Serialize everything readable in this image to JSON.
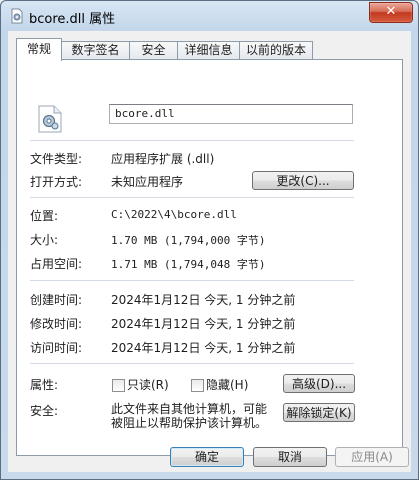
{
  "window": {
    "title": "bcore.dll 属性",
    "close_glyph": "✕"
  },
  "tabs": [
    "常规",
    "数字签名",
    "安全",
    "详细信息",
    "以前的版本"
  ],
  "file": {
    "name": "bcore.dll"
  },
  "rows": {
    "type_label": "文件类型:",
    "type_value": "应用程序扩展 (.dll)",
    "open_label": "打开方式:",
    "open_value": "未知应用程序",
    "change_button": "更改(C)...",
    "location_label": "位置:",
    "location_value": "C:\\2022\\4\\bcore.dll",
    "size_label": "大小:",
    "size_value": "1.70 MB (1,794,000 字节)",
    "disk_label": "占用空间:",
    "disk_value": "1.71 MB (1,794,048 字节)",
    "created_label": "创建时间:",
    "created_value": "2024年1月12日 今天, 1 分钟之前",
    "modified_label": "修改时间:",
    "modified_value": "2024年1月12日 今天, 1 分钟之前",
    "accessed_label": "访问时间:",
    "accessed_value": "2024年1月12日 今天, 1 分钟之前",
    "attr_label": "属性:",
    "readonly_label": "只读(R)",
    "hidden_label": "隐藏(H)",
    "advanced_button": "高级(D)...",
    "security_label": "安全:",
    "security_text_1": "此文件来自其他计算机，可能",
    "security_text_2": "被阻止以帮助保护该计算机。",
    "unblock_button": "解除锁定(K)"
  },
  "footer": {
    "ok": "确定",
    "cancel": "取消",
    "apply": "应用(A)"
  },
  "colors": {
    "frame": "#c3d6ea",
    "close": "#c23a21",
    "panel": "#ffffff"
  }
}
